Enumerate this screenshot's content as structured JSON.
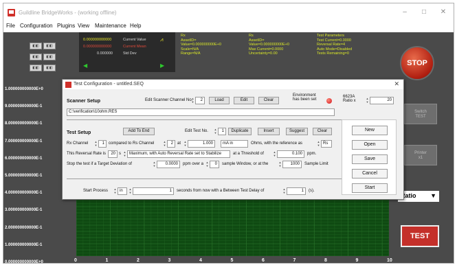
{
  "window": {
    "title": "Guildline BridgeWorks - (working offline)",
    "controls": [
      "–",
      "□",
      "✕"
    ]
  },
  "menu": [
    "File",
    "Configuration",
    "Plugins",
    "View",
    "Maintenance",
    "Help"
  ],
  "stats": {
    "current_value": "0.000000000000",
    "current_value_label": "Current Value",
    "current_mean": "0.000000000000",
    "current_mean_label": "Current Mean",
    "std_dev": "0.000000",
    "std_dev_label": "Std Dev"
  },
  "rx_box": {
    "title": "Rx",
    "lines": [
      "AssetID=",
      "Value=0.000000000E+0",
      "Scale=N/A",
      "Range=N/A"
    ]
  },
  "rs_box": {
    "title": "Rs",
    "lines": [
      "AssetID=",
      "Value=0.000000000E+0",
      "Max Current=0.0000",
      "Uncertainty=0.00"
    ]
  },
  "test_params": {
    "title": "Test Parameters",
    "lines": [
      "Test Current=0.0000",
      "Reversal Rate=4",
      "Auto Mode=Disabled",
      "Tests Remaining=0"
    ]
  },
  "stop_label": "STOP",
  "side_buttons": [
    {
      "label": "Switch\nTEST"
    },
    {
      "label": "Printer\nx1"
    }
  ],
  "ratio_label": "Ratio",
  "test_label": "TEST",
  "chart": {
    "y_ticks": [
      "1.000000000000E+0",
      "9.000000000000E-1",
      "8.000000000000E-1",
      "7.000000000000E-1",
      "6.000000000000E-1",
      "5.000000000000E-1",
      "4.000000000000E-1",
      "3.000000000000E-1",
      "2.000000000000E-1",
      "1.000000000000E-1",
      "0.000000000000E+0"
    ],
    "x_ticks": [
      "0",
      "1",
      "2",
      "3",
      "4",
      "5",
      "6",
      "7",
      "8",
      "9",
      "10"
    ]
  },
  "dialog": {
    "title": "Test Configuration - untitled.SEQ",
    "scanner_setup": "Scanner Setup",
    "edit_scanner_label": "Edit Scanner Channel No.",
    "scanner_channel": "2",
    "load": "Load",
    "edit": "Edit",
    "clear": "Clear",
    "env_label": "Environment has been set",
    "ratio_label": "6623A Ratio x",
    "ratio_value": "20",
    "path": "C:\\verification\\10ohm.RES",
    "test_setup": "Test Setup",
    "add_to_end": "Add To End",
    "edit_test_label": "Edit Test No.",
    "test_no": "1",
    "duplicate": "Duplicate",
    "insert": "Insert",
    "suggest": "Suggest",
    "clear2": "Clear",
    "rx_channel_label": "Rx Channel",
    "rx_channel": "1",
    "compared_label": "compared to Rs Channel",
    "rs_channel": "2",
    "at_label": "at",
    "current_value": "1.000",
    "unit": "mA in",
    "ohms_label": "Ohms, with the reference as",
    "ref": "Rs",
    "reversal_label": "This Reversal Rate is",
    "reversal_rate": "20",
    "s_label": "s",
    "mode": "Maximum, with Auto Reversal Rate set to Stabilize",
    "threshold_label": "at a Threshold of",
    "threshold": "0.100",
    "ppm": "ppm.",
    "stop_label": "Stop the test if a Target Deviation of",
    "deviation": "0.0000",
    "ppm_over": "ppm over a",
    "window": "0",
    "window_label": "sample Window, or at the",
    "sample_limit": "1000",
    "sample_limit_label": "Sample Limit",
    "start_label": "Start Process",
    "start_mode": "in",
    "start_seconds": "1",
    "seconds_label": "seconds from now with a Between Test Delay of",
    "delay": "1",
    "delay_unit": "(s).",
    "right_buttons": [
      "New",
      "Open",
      "Save",
      "Cancel",
      "Start"
    ]
  },
  "colors": {
    "background_dark": "#4a4a4a",
    "chart_green": "#0f4a12",
    "accent_red": "#c4302a",
    "info_yellow": "#d8e628"
  }
}
